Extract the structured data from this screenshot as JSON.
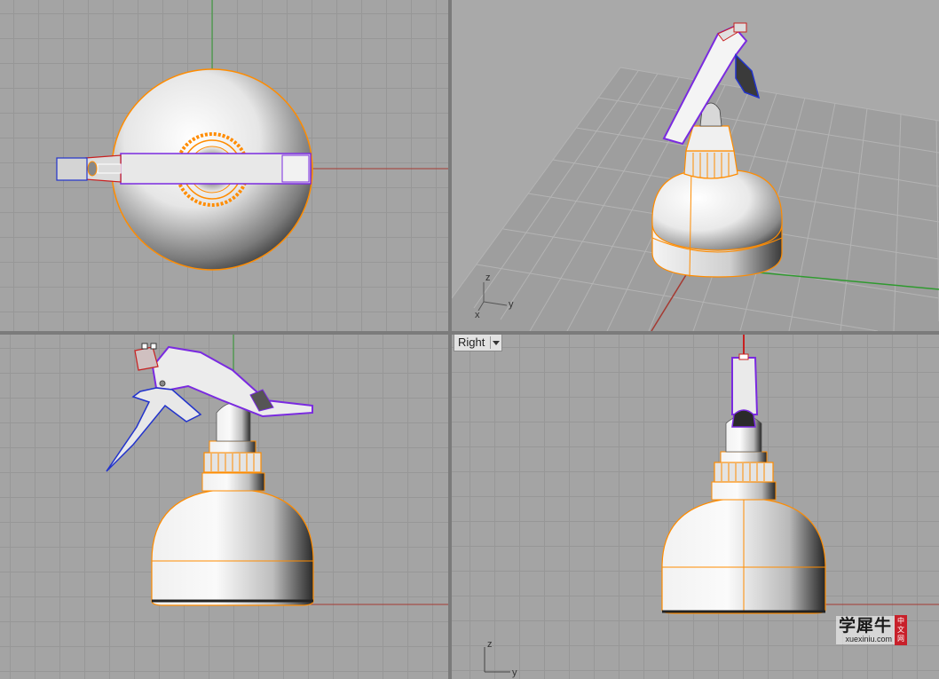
{
  "viewports": {
    "right": {
      "label": "Right"
    }
  },
  "axes": {
    "persp": {
      "z": "z",
      "y": "y",
      "x": "x"
    },
    "right": {
      "z": "z",
      "y": "y"
    }
  },
  "watermark": {
    "title": "学犀牛",
    "url": "xuexiniu.com",
    "badge": [
      "中",
      "文",
      "网"
    ]
  },
  "colors": {
    "grid_bg": "#a4a4a4",
    "grid_line": "#979797",
    "x_axis": "#a53a32",
    "y_axis": "#2f9a2f",
    "edge_orange": "#ff8c00",
    "edge_purple": "#7a2ae0",
    "edge_blue": "#2233cc",
    "edge_red": "#c82020"
  },
  "icons": [
    "viewport-dropdown-icon",
    "axis-gizmo-icon"
  ]
}
